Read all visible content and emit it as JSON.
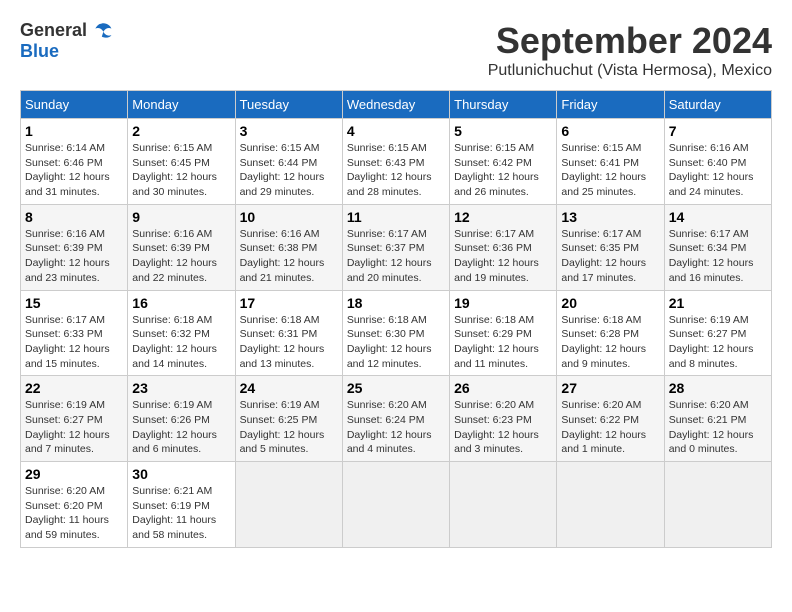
{
  "logo": {
    "general": "General",
    "blue": "Blue"
  },
  "title": "September 2024",
  "subtitle": "Putlunichuchut (Vista Hermosa), Mexico",
  "days_header": [
    "Sunday",
    "Monday",
    "Tuesday",
    "Wednesday",
    "Thursday",
    "Friday",
    "Saturday"
  ],
  "weeks": [
    [
      {
        "day": "1",
        "sunrise": "6:14 AM",
        "sunset": "6:46 PM",
        "daylight": "12 hours and 31 minutes."
      },
      {
        "day": "2",
        "sunrise": "6:15 AM",
        "sunset": "6:45 PM",
        "daylight": "12 hours and 30 minutes."
      },
      {
        "day": "3",
        "sunrise": "6:15 AM",
        "sunset": "6:44 PM",
        "daylight": "12 hours and 29 minutes."
      },
      {
        "day": "4",
        "sunrise": "6:15 AM",
        "sunset": "6:43 PM",
        "daylight": "12 hours and 28 minutes."
      },
      {
        "day": "5",
        "sunrise": "6:15 AM",
        "sunset": "6:42 PM",
        "daylight": "12 hours and 26 minutes."
      },
      {
        "day": "6",
        "sunrise": "6:15 AM",
        "sunset": "6:41 PM",
        "daylight": "12 hours and 25 minutes."
      },
      {
        "day": "7",
        "sunrise": "6:16 AM",
        "sunset": "6:40 PM",
        "daylight": "12 hours and 24 minutes."
      }
    ],
    [
      {
        "day": "8",
        "sunrise": "6:16 AM",
        "sunset": "6:39 PM",
        "daylight": "12 hours and 23 minutes."
      },
      {
        "day": "9",
        "sunrise": "6:16 AM",
        "sunset": "6:39 PM",
        "daylight": "12 hours and 22 minutes."
      },
      {
        "day": "10",
        "sunrise": "6:16 AM",
        "sunset": "6:38 PM",
        "daylight": "12 hours and 21 minutes."
      },
      {
        "day": "11",
        "sunrise": "6:17 AM",
        "sunset": "6:37 PM",
        "daylight": "12 hours and 20 minutes."
      },
      {
        "day": "12",
        "sunrise": "6:17 AM",
        "sunset": "6:36 PM",
        "daylight": "12 hours and 19 minutes."
      },
      {
        "day": "13",
        "sunrise": "6:17 AM",
        "sunset": "6:35 PM",
        "daylight": "12 hours and 17 minutes."
      },
      {
        "day": "14",
        "sunrise": "6:17 AM",
        "sunset": "6:34 PM",
        "daylight": "12 hours and 16 minutes."
      }
    ],
    [
      {
        "day": "15",
        "sunrise": "6:17 AM",
        "sunset": "6:33 PM",
        "daylight": "12 hours and 15 minutes."
      },
      {
        "day": "16",
        "sunrise": "6:18 AM",
        "sunset": "6:32 PM",
        "daylight": "12 hours and 14 minutes."
      },
      {
        "day": "17",
        "sunrise": "6:18 AM",
        "sunset": "6:31 PM",
        "daylight": "12 hours and 13 minutes."
      },
      {
        "day": "18",
        "sunrise": "6:18 AM",
        "sunset": "6:30 PM",
        "daylight": "12 hours and 12 minutes."
      },
      {
        "day": "19",
        "sunrise": "6:18 AM",
        "sunset": "6:29 PM",
        "daylight": "12 hours and 11 minutes."
      },
      {
        "day": "20",
        "sunrise": "6:18 AM",
        "sunset": "6:28 PM",
        "daylight": "12 hours and 9 minutes."
      },
      {
        "day": "21",
        "sunrise": "6:19 AM",
        "sunset": "6:27 PM",
        "daylight": "12 hours and 8 minutes."
      }
    ],
    [
      {
        "day": "22",
        "sunrise": "6:19 AM",
        "sunset": "6:27 PM",
        "daylight": "12 hours and 7 minutes."
      },
      {
        "day": "23",
        "sunrise": "6:19 AM",
        "sunset": "6:26 PM",
        "daylight": "12 hours and 6 minutes."
      },
      {
        "day": "24",
        "sunrise": "6:19 AM",
        "sunset": "6:25 PM",
        "daylight": "12 hours and 5 minutes."
      },
      {
        "day": "25",
        "sunrise": "6:20 AM",
        "sunset": "6:24 PM",
        "daylight": "12 hours and 4 minutes."
      },
      {
        "day": "26",
        "sunrise": "6:20 AM",
        "sunset": "6:23 PM",
        "daylight": "12 hours and 3 minutes."
      },
      {
        "day": "27",
        "sunrise": "6:20 AM",
        "sunset": "6:22 PM",
        "daylight": "12 hours and 1 minute."
      },
      {
        "day": "28",
        "sunrise": "6:20 AM",
        "sunset": "6:21 PM",
        "daylight": "12 hours and 0 minutes."
      }
    ],
    [
      {
        "day": "29",
        "sunrise": "6:20 AM",
        "sunset": "6:20 PM",
        "daylight": "11 hours and 59 minutes."
      },
      {
        "day": "30",
        "sunrise": "6:21 AM",
        "sunset": "6:19 PM",
        "daylight": "11 hours and 58 minutes."
      },
      null,
      null,
      null,
      null,
      null
    ]
  ]
}
